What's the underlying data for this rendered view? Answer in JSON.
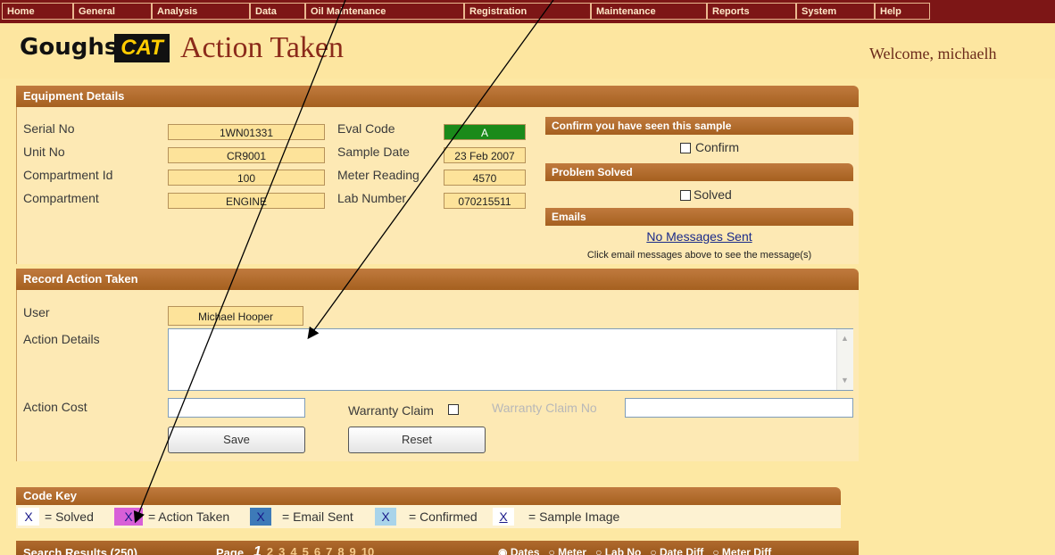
{
  "menu": {
    "items": [
      {
        "label": "Home"
      },
      {
        "label": "General"
      },
      {
        "label": "Analysis"
      },
      {
        "label": "Data"
      },
      {
        "label": "Oil Maintenance"
      },
      {
        "label": "Registration"
      },
      {
        "label": "Maintenance"
      },
      {
        "label": "Reports"
      },
      {
        "label": "System"
      },
      {
        "label": "Help"
      }
    ]
  },
  "header": {
    "brand_name": "Goughs",
    "brand_logo": "CAT",
    "page_title": "Action Taken",
    "welcome": "Welcome, michaelh"
  },
  "equipment": {
    "title": "Equipment Details",
    "serial_label": "Serial No",
    "serial_value": "1WN01331",
    "unit_label": "Unit No",
    "unit_value": "CR9001",
    "compartment_id_label": "Compartment Id",
    "compartment_id_value": "100",
    "compartment_label": "Compartment",
    "compartment_value": "ENGINE",
    "eval_label": "Eval Code",
    "eval_value": "A",
    "eval_color": "#1a8a1a",
    "sample_date_label": "Sample Date",
    "sample_date_value": "23 Feb 2007",
    "meter_label": "Meter Reading",
    "meter_value": "4570",
    "lab_label": "Lab Number",
    "lab_value": "070215511"
  },
  "side": {
    "confirm_title": "Confirm you have seen this sample",
    "confirm_label": "Confirm",
    "solved_title": "Problem Solved",
    "solved_label": "Solved",
    "emails_title": "Emails",
    "emails_link": "No Messages Sent",
    "emails_hint": "Click email messages above to see the message(s)"
  },
  "action": {
    "title": "Record Action Taken",
    "user_label": "User",
    "user_value": "Michael Hooper",
    "details_label": "Action Details",
    "details_value": "",
    "cost_label": "Action Cost",
    "cost_value": "",
    "warranty_label": "Warranty Claim",
    "warranty_no_label": "Warranty Claim No",
    "warranty_no_value": "",
    "save_label": "Save",
    "reset_label": "Reset"
  },
  "code_key": {
    "title": "Code Key",
    "mark": "X",
    "solved": "= Solved",
    "action_taken": "= Action Taken",
    "email_sent": "= Email Sent",
    "confirmed": "= Confirmed",
    "sample_image": "= Sample Image",
    "colors": {
      "solved": "#ffffff",
      "action_taken": "#d85fd8",
      "email_sent": "#3d7ab8",
      "confirmed": "#a9d4ea",
      "sample_image": "#ffffff"
    }
  },
  "search": {
    "title": "Search Results (250)",
    "page_label": "Page",
    "pages": [
      "1",
      "2",
      "3",
      "4",
      "5",
      "6",
      "7",
      "8",
      "9",
      "10"
    ],
    "options": [
      "Dates",
      "Meter",
      "Lab No",
      "Date Diff",
      "Meter Diff"
    ]
  }
}
